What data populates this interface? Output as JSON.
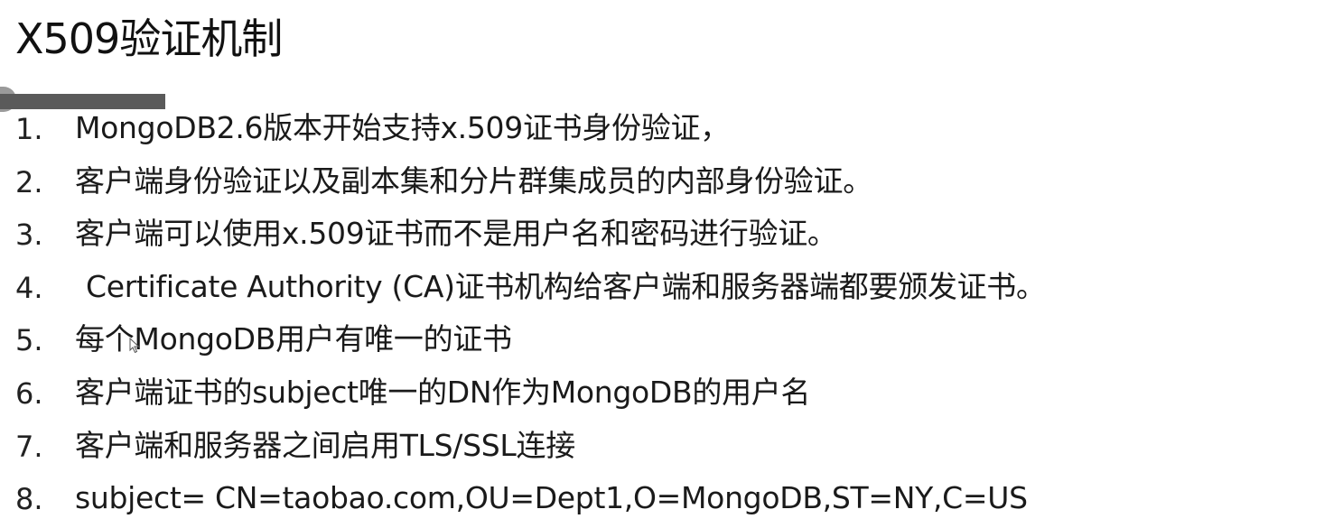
{
  "slide": {
    "title": "X509验证机制"
  },
  "items": [
    {
      "number": "1.",
      "text": "MongoDB2.6版本开始支持x.509证书身份验证，"
    },
    {
      "number": "2.",
      "text": "客户端身份验证以及副本集和分片群集成员的内部身份验证。"
    },
    {
      "number": "3.",
      "text": "客户端可以使用x.509证书而不是用户名和密码进行验证。"
    },
    {
      "number": "4.",
      "text": "Certificate Authority (CA)证书机构给客户端和服务器端都要颁发证书。"
    },
    {
      "number": "5.",
      "text": "每个MongoDB用户有唯一的证书"
    },
    {
      "number": "6.",
      "text": "客户端证书的subject唯一的DN作为MongoDB的用户名"
    },
    {
      "number": "7.",
      "text": "客户端和服务器之间启用TLS/SSL连接"
    },
    {
      "number": "8.",
      "text": "subject= CN=taobao.com,OU=Dept1,O=MongoDB,ST=NY,C=US"
    }
  ],
  "icons": {
    "cursor": "mouse-pointer-icon"
  }
}
